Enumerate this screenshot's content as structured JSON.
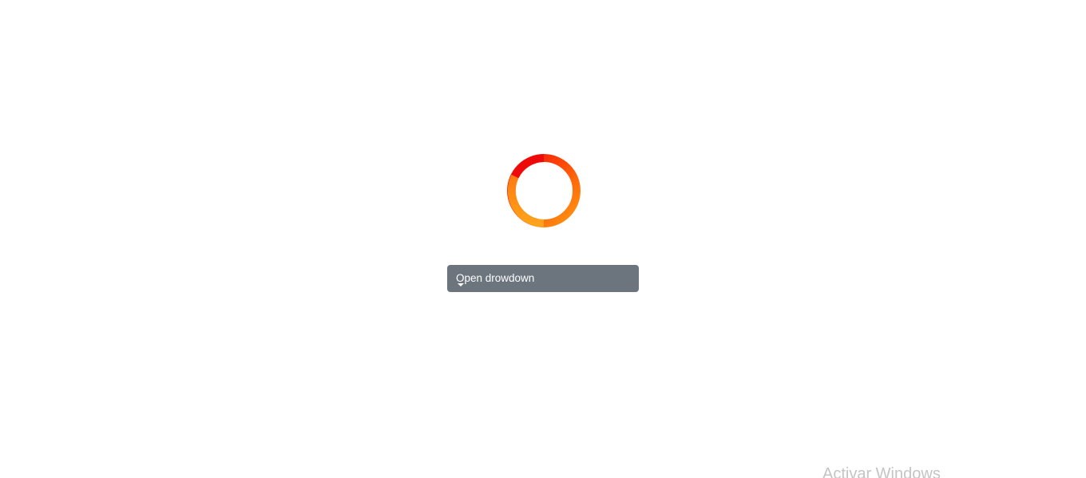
{
  "loader": {
    "icon": "loading-spinner-icon",
    "colors": {
      "start": "#ee0a0a",
      "end": "#ff9a10"
    }
  },
  "dropdown": {
    "label": "Open drowdown",
    "icon": "caret-down-icon",
    "color": "#6c757d"
  },
  "watermark": {
    "text": "Activar Windows"
  }
}
